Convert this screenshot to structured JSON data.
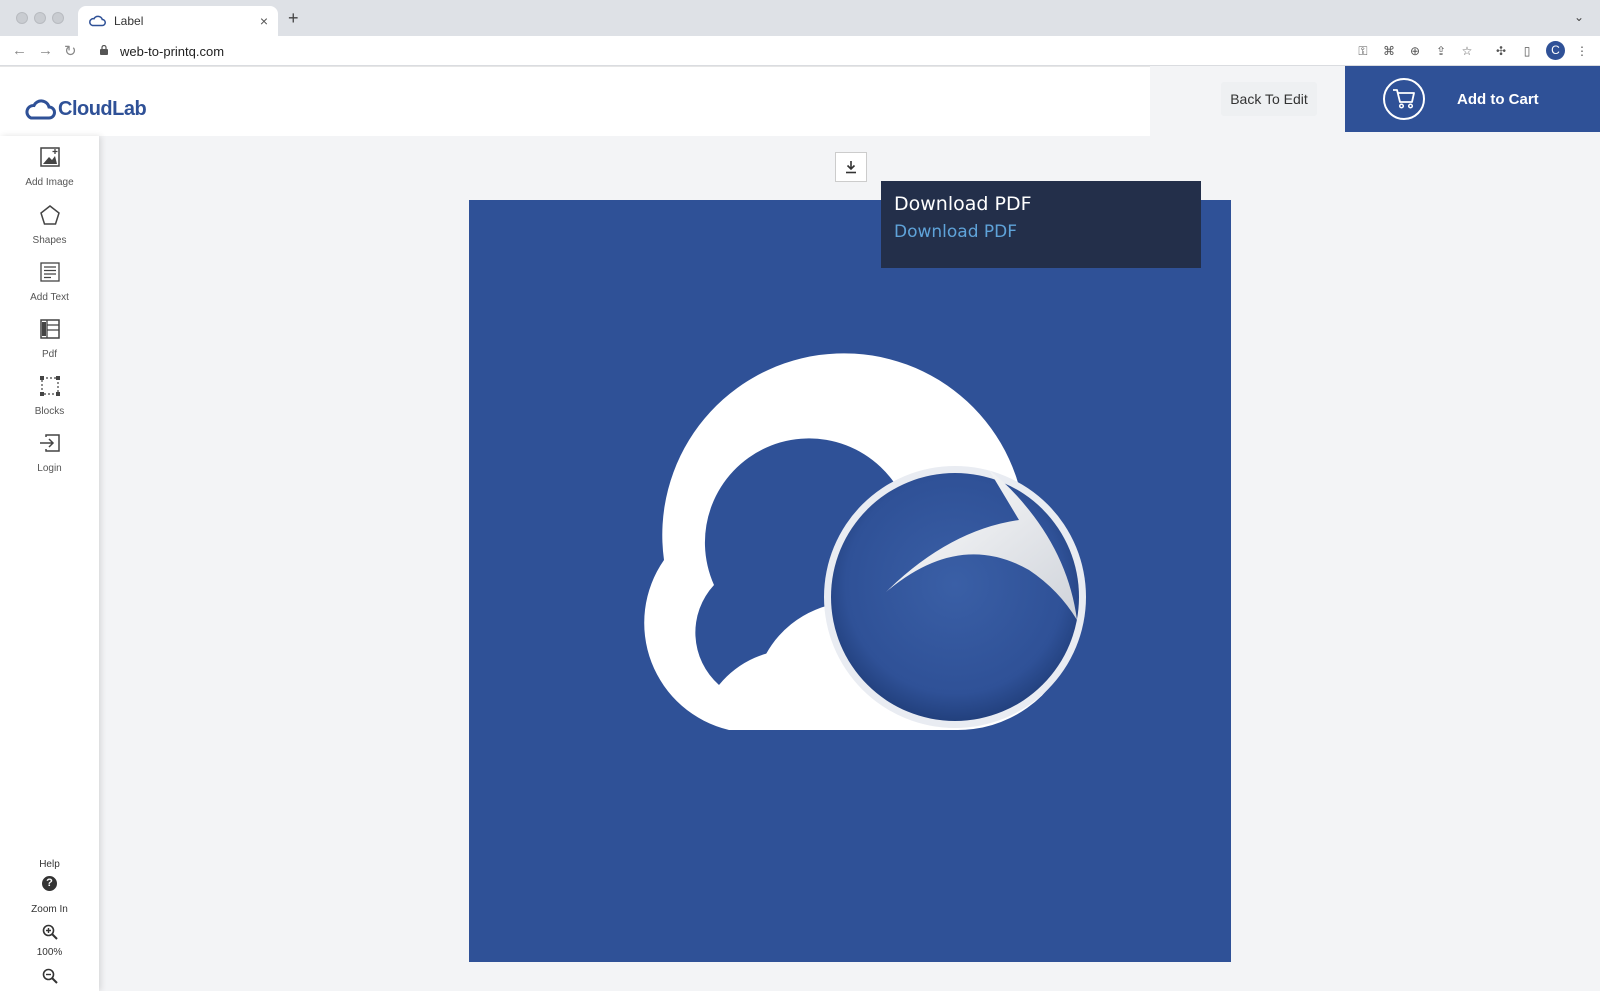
{
  "browser": {
    "tab_title": "Label",
    "url": "web-to-printq.com",
    "profile_initial": "C"
  },
  "header": {
    "logo_text": "CloudLab",
    "back_label": "Back To Edit",
    "cart_label": "Add to Cart"
  },
  "sidebar": {
    "items": [
      {
        "label": "Add Image",
        "icon": "add-image-icon"
      },
      {
        "label": "Shapes",
        "icon": "pentagon-icon"
      },
      {
        "label": "Add Text",
        "icon": "text-frame-icon"
      },
      {
        "label": "Pdf",
        "icon": "pdf-layout-icon"
      },
      {
        "label": "Blocks",
        "icon": "blocks-icon"
      },
      {
        "label": "Login",
        "icon": "login-icon"
      }
    ],
    "help_label": "Help",
    "zoom_in_label": "Zoom In",
    "zoom_level": "100%"
  },
  "tooltip": {
    "title": "Download PDF",
    "link": "Download PDF"
  },
  "colors": {
    "brand": "#2f5197",
    "tooltip_bg": "#232f4a",
    "tooltip_link": "#5fa3d9"
  }
}
